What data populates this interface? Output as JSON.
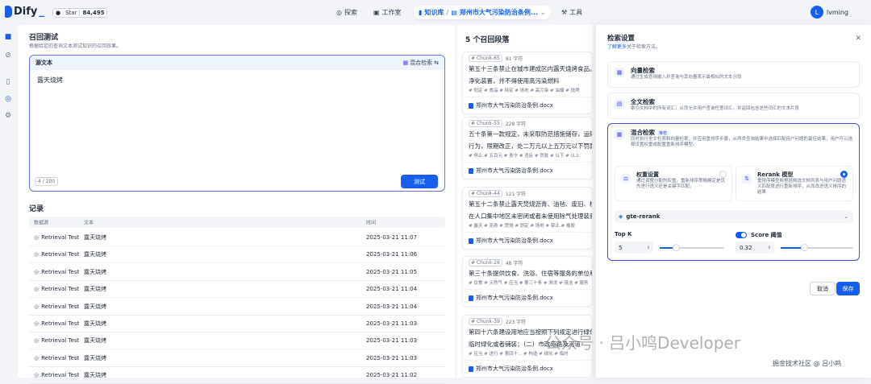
{
  "header": {
    "app_name": "Dify",
    "github_label": "Star",
    "github_count": "84,495",
    "nav": [
      {
        "label": "探索",
        "icon": "compass-icon"
      },
      {
        "label": "工作室",
        "icon": "studio-icon"
      },
      {
        "label": "知识库",
        "icon": "book-icon"
      },
      {
        "label": "郑州市大气污染防治条例...",
        "icon": "dataset-icon"
      },
      {
        "label": "工具",
        "icon": "tools-icon"
      }
    ],
    "user_initial": "L",
    "user_name": "lvming"
  },
  "main": {
    "title": "召回测试",
    "subtitle": "根据给定的查询文本测试知识的召回效果。",
    "source_label": "源文本",
    "mode_label": "混合检索",
    "query_text": "露天烧烤",
    "char_count": "4 / 200",
    "test_button": "测试",
    "records_title": "记录",
    "columns": [
      "数据源",
      "文本",
      "时间"
    ],
    "records": [
      {
        "source": "Retrieval Test",
        "text": "露天烧烤",
        "time": "2025-03-21 11:07"
      },
      {
        "source": "Retrieval Test",
        "text": "露天烧烤",
        "time": "2025-03-21 11:06"
      },
      {
        "source": "Retrieval Test",
        "text": "露天烧烤",
        "time": "2025-03-21 11:05"
      },
      {
        "source": "Retrieval Test",
        "text": "露天烧烤",
        "time": "2025-03-21 11:04"
      },
      {
        "source": "Retrieval Test",
        "text": "露天烧烤",
        "time": "2025-03-21 11:04"
      },
      {
        "source": "Retrieval Test",
        "text": "露天烧烤",
        "time": "2025-03-21 11:03"
      },
      {
        "source": "Retrieval Test",
        "text": "露天烧烤",
        "time": "2025-03-21 11:03"
      },
      {
        "source": "Retrieval Test",
        "text": "露天烧烤",
        "time": "2025-03-21 11:03"
      },
      {
        "source": "Retrieval Test",
        "text": "露天烧烤",
        "time": "2025-03-21 11:02"
      }
    ]
  },
  "results": {
    "title": "5 个召回段落",
    "chunks": [
      {
        "id": "Chunk-65",
        "chars": "81 字符",
        "line1": "第五十三条禁止在城市建成区内露天烧烤食品。",
        "line2": "净化装置，并不得使用高污染燃料",
        "tags": "# 划定 # 食品 # 特定 # 场地 # 高污染 # 油烟 # 烧烤",
        "doc": "郑州市大气污染防治条例.docx"
      },
      {
        "id": "Chunk-55",
        "chars": "228 字符",
        "line1": "五十条第一款规定，未采取防范措施储存，运输",
        "line2": "行为，限期改正，处二万元以上五万元以下罚款",
        "tags": "# 停止 # 五百元 # 责令 # 违反 # 罚款 # 以下 # 以上",
        "doc": "郑州市大气污染防治条例.docx"
      },
      {
        "id": "Chunk-44",
        "chars": "121 字符",
        "line1": "第五十二条禁止露天焚烧沥青、油毡、废旧、橡",
        "line2": "在人口集中地区未密闭或者未使用除气处理装置",
        "tags": "# 露天 # 沥青 # 焚烧 # 划定 # 场地 # 禁止 # 橡胶",
        "doc": "郑州市大气污染防治条例.docx"
      },
      {
        "id": "Chunk-26",
        "chars": "48 字符",
        "line1": "第三十条提供饮食、洗浴、住宿等服务的单位和",
        "line2": "",
        "tags": "# 饮食 # 天然气 # 应当 # 第三十条 # 淋洗 # 清洁 # 服务",
        "doc": "郑州市大气污染防治条例.docx"
      },
      {
        "id": "Chunk-39",
        "chars": "223 字符",
        "line1": "第四十六条建设用地应当按照下列规定进行绿化",
        "line2": "临时绿化或者铺装；（二）市政道路及河道",
        "tags": "# 应当 # 进行 # 第四十... # 构造 # 绿化 # 临时",
        "doc": "郑州市大气污染防治条例.docx"
      }
    ]
  },
  "panel": {
    "title": "检索设置",
    "learn_more": "了解更多",
    "learn_more_suffix": "关于检索方法。",
    "options": [
      {
        "title": "向量检索",
        "desc": "通过生成查询嵌入并查询与其向量表示最相似的文本分段"
      },
      {
        "title": "全文检索",
        "desc": "索引文档中的所有词汇，从而允许用户查询任意词汇，并返回包含这些词汇的文本片段"
      },
      {
        "title": "混合检索",
        "badge": "推荐",
        "desc": "同时执行全文检索和向量检索，并应用重排序步骤，从两类查询结果中选择匹配用户问题的最佳结果，用户可以选择设置权重或配置重新排序模型。"
      }
    ],
    "weight_title": "权重设置",
    "weight_desc": "通过调整分配的权重，重新排序策略确定是优先进行语义还是关键字匹配。",
    "rerank_title": "Rerank 模型",
    "rerank_desc": "重排序模型将根据候选文档列表与用户问题语义匹配度进行重新排序，从而改进语义排序的结果",
    "model": "gte-rerank",
    "topk_label": "Top K",
    "topk_value": "5",
    "topk_fraction": 0.25,
    "score_label": "Score 阈值",
    "score_value": "0.32",
    "score_fraction": 0.32,
    "cancel": "取消",
    "save": "保存"
  },
  "watermark": {
    "main": "公众号 · 吕小鸣Developer",
    "footer": "掘金技术社区 @ 吕小鸣"
  },
  "colors": {
    "accent": "#155eef",
    "selected_border": "#444ce7"
  }
}
